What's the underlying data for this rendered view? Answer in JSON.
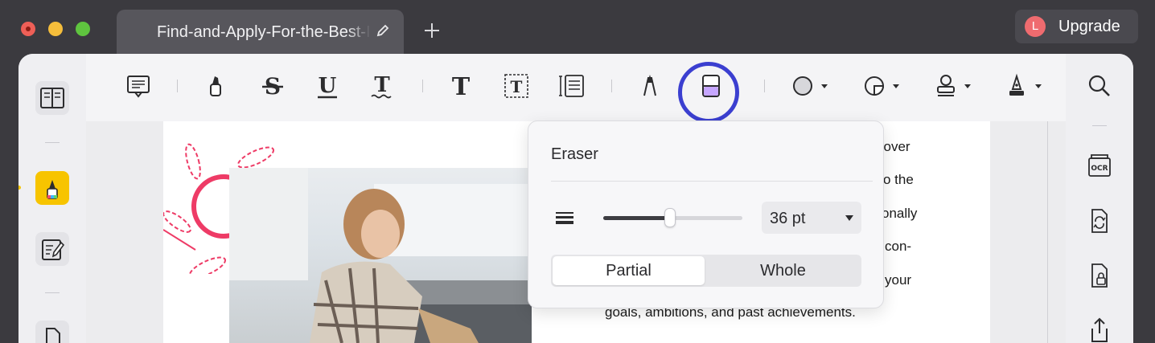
{
  "window": {
    "tab_title": "Find-and-Apply-For-the-Best-Institutes",
    "upgrade_label": "Upgrade",
    "avatar_letter": "L"
  },
  "toolbar": {
    "icons": [
      "comment-icon",
      "highlighter-icon",
      "strikethrough-icon",
      "underline-icon",
      "squiggly-text-icon",
      "text-icon",
      "textbox-icon",
      "text-callout-icon",
      "pencil-icon",
      "eraser-icon",
      "shape-icon",
      "area-highlight-icon",
      "stamp-icon",
      "signature-icon"
    ]
  },
  "eraser_panel": {
    "title": "Eraser",
    "size_label": "36 pt",
    "size_fraction": 0.48,
    "mode_partial": "Partial",
    "mode_whole": "Whole",
    "selected_mode": "Partial"
  },
  "document": {
    "lines": [
      "cover",
      "o the",
      "onally",
      "con-",
      "your",
      "goals, ambitions, and past achievements."
    ]
  },
  "colors": {
    "accent_ring": "#3b3fd0",
    "highlighter_yellow": "#f5c400",
    "sun_pink": "#ee3b66"
  }
}
